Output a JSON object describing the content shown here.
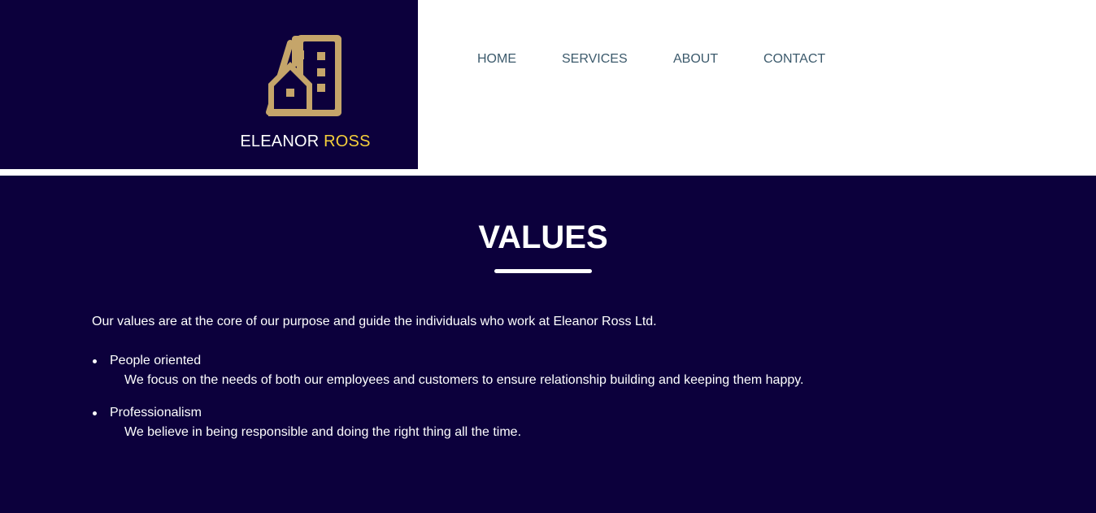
{
  "brand": {
    "logo_icon": "building-house-icon",
    "logo_color": "#c5a56a",
    "name_first": "ELEANOR",
    "name_last": "ROSS",
    "accent_color": "#f5cf3b",
    "background_color": "#0c003c"
  },
  "nav": {
    "items": [
      {
        "label": "HOME"
      },
      {
        "label": "SERVICES"
      },
      {
        "label": "ABOUT"
      },
      {
        "label": "CONTACT"
      }
    ]
  },
  "values": {
    "title": "VALUES",
    "intro": "Our values are at the core of our purpose and guide the individuals who work at Eleanor Ross Ltd.",
    "items": [
      {
        "name": "People oriented",
        "description": "We focus on the needs of both our employees and customers to ensure relationship building and keeping them happy."
      },
      {
        "name": "Professionalism",
        "description": "We believe in being responsible and doing the right thing all the time."
      }
    ]
  }
}
